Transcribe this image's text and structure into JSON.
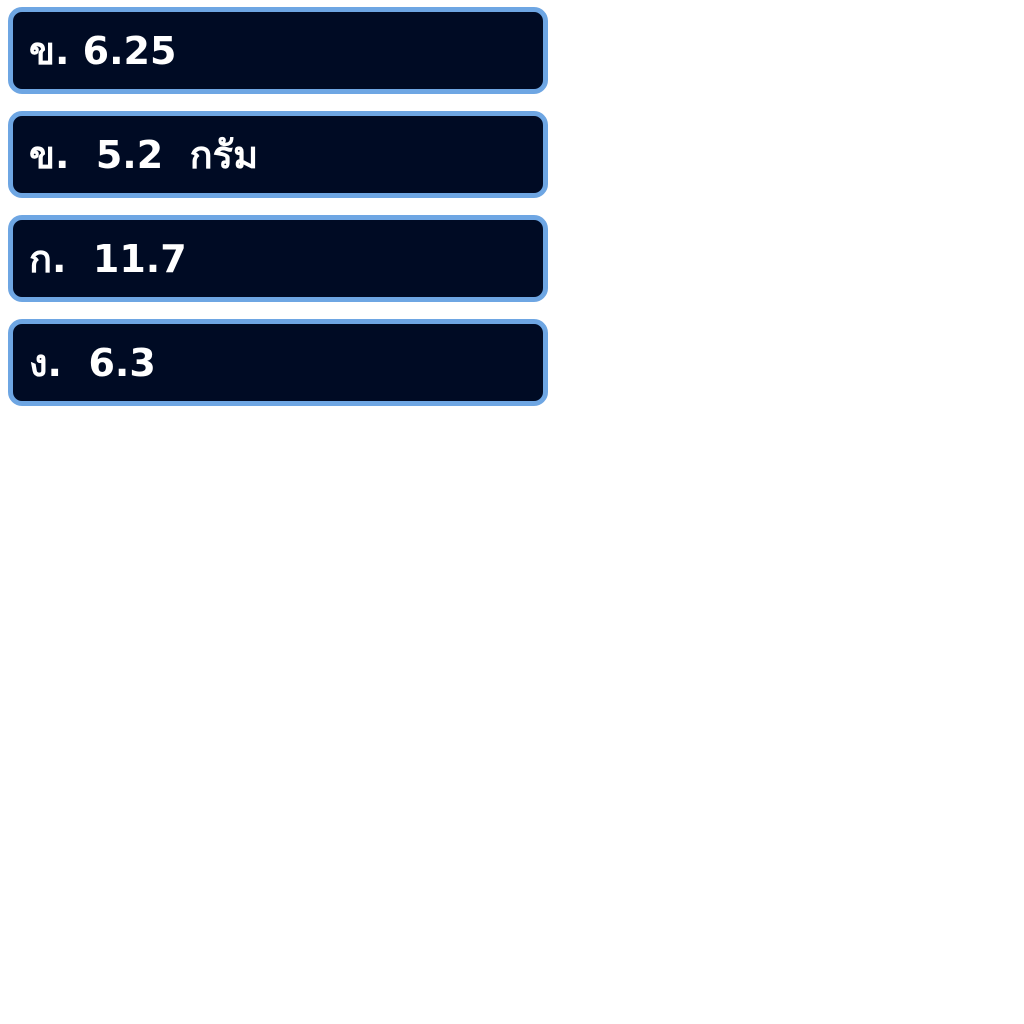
{
  "options": [
    {
      "label": "ข. 6.25"
    },
    {
      "label": "ข.  5.2  กรัม"
    },
    {
      "label": "ก.  11.7"
    },
    {
      "label": "ง.  6.3"
    }
  ],
  "colors": {
    "option_background": "#000b24",
    "option_border": "#6ea6e3",
    "option_text": "#ffffff",
    "page_background": "#ffffff"
  }
}
